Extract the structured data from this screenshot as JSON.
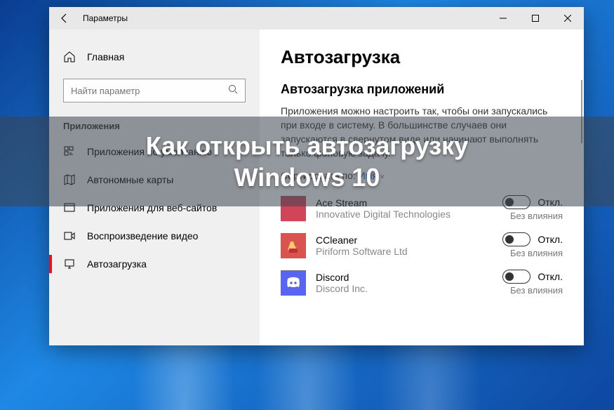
{
  "titlebar": {
    "title": "Параметры"
  },
  "sidebar": {
    "home": "Главная",
    "search_placeholder": "Найти параметр",
    "section": "Приложения",
    "items": [
      {
        "label": "Приложения по умолчанию"
      },
      {
        "label": "Автономные карты"
      },
      {
        "label": "Приложения для веб-сайтов"
      },
      {
        "label": "Воспроизведение видео"
      },
      {
        "label": "Автозагрузка"
      }
    ]
  },
  "main": {
    "heading": "Автозагрузка",
    "subheading": "Автозагрузка приложений",
    "description": "Приложения можно настроить так, чтобы они запускались при входе в систему. В большинстве случаев они запускаются в свернутом виде или начинают выполнять только фоновую задачу.",
    "sort_label": "Сортировать по:",
    "sort_value": "Имя",
    "apps": [
      {
        "name": "Ace Stream",
        "publisher": "Innovative Digital Technologies",
        "state": "Откл.",
        "impact": "Без влияния",
        "color": "#d04558"
      },
      {
        "name": "CCleaner",
        "publisher": "Piriform Software Ltd",
        "state": "Откл.",
        "impact": "Без влияния",
        "color": "#d9534f"
      },
      {
        "name": "Discord",
        "publisher": "Discord Inc.",
        "state": "Откл.",
        "impact": "Без влияния",
        "color": "#5865F2"
      }
    ]
  },
  "overlay": {
    "line1": "Как открыть автозагрузку",
    "line2": "Windows 10"
  }
}
